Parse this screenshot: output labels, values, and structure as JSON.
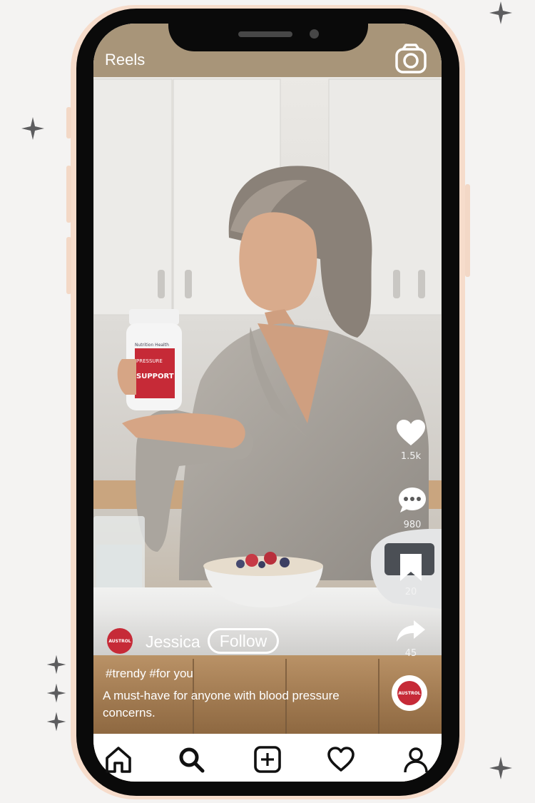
{
  "header": {
    "title": "Reels"
  },
  "actions": {
    "likes": "1.5k",
    "comments": "980",
    "saves": "20",
    "shares": "45"
  },
  "post": {
    "avatar_text": "AUSTROL",
    "username": "Jessica",
    "follow_label": "Follow",
    "hashtags": "#trendy #for you",
    "caption": "A must-have for anyone with blood pressure concerns.",
    "music_avatar_text": "AUSTROL"
  },
  "product": {
    "brand_line": "Nutrition Health",
    "label_top": "PRESSURE",
    "label_main": "SUPPORT"
  },
  "bottom_nav": {
    "items": [
      "home-icon",
      "search-icon",
      "create-icon",
      "activity-icon",
      "profile-icon"
    ]
  },
  "colors": {
    "brand_red": "#c62a37",
    "phone_frame": "#f6dccb",
    "phone_body": "#0a0a0a"
  }
}
